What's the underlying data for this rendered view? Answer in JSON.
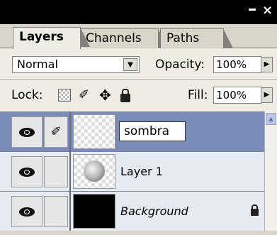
{
  "window": {
    "minimize_label": "_",
    "close_label": "×"
  },
  "tabs": [
    {
      "label": "Layers",
      "active": true
    },
    {
      "label": "Channels",
      "active": false
    },
    {
      "label": "Paths",
      "active": false
    }
  ],
  "panel_menu_icon": "arrow-right-icon",
  "blend_mode": {
    "value": "Normal"
  },
  "opacity": {
    "label": "Opacity:",
    "value": "100%"
  },
  "lock": {
    "label": "Lock:",
    "icons": [
      "lock-transparent-icon",
      "lock-paint-icon",
      "lock-move-icon",
      "lock-all-icon"
    ]
  },
  "fill": {
    "label": "Fill:",
    "value": "100%"
  },
  "layers": [
    {
      "name": "sombra",
      "selected": true,
      "editing": true,
      "thumbnail": "transparent"
    },
    {
      "name": "Layer 1",
      "selected": false,
      "thumbnail": "gray-sphere"
    },
    {
      "name": "Background",
      "selected": false,
      "locked": true,
      "thumbnail": "black"
    }
  ],
  "colors": {
    "selected_row": "#7b8cb8",
    "row": "#e6eaf2",
    "panel": "#efece3"
  }
}
